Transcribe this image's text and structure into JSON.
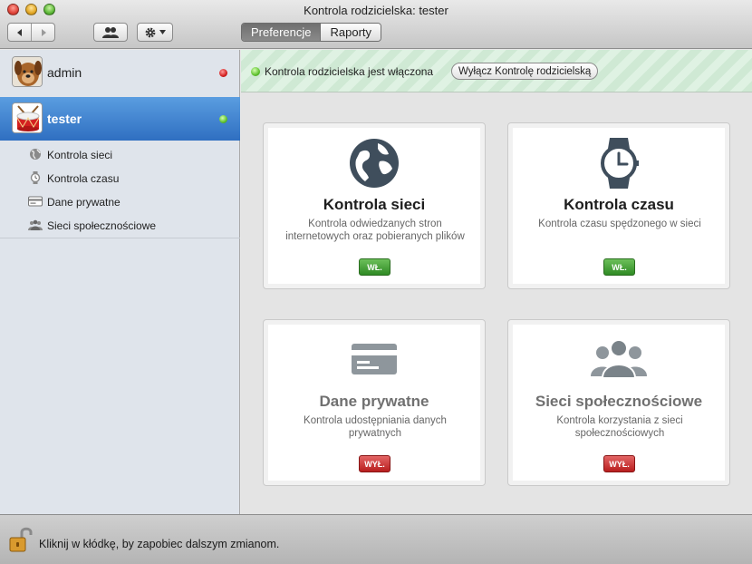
{
  "window": {
    "title": "Kontrola rodzicielska: tester"
  },
  "toolbar": {
    "back_icon": "chevron-left-icon",
    "forward_icon": "chevron-right-icon",
    "users_icon": "users-icon",
    "gear_icon": "gear-icon",
    "tabs": [
      {
        "label": "Preferencje",
        "active": true
      },
      {
        "label": "Raporty",
        "active": false
      }
    ]
  },
  "sidebar": {
    "users": [
      {
        "name": "admin",
        "status": "red"
      },
      {
        "name": "tester",
        "status": "green",
        "selected": true
      }
    ],
    "items": [
      {
        "label": "Kontrola sieci",
        "icon": "globe-icon"
      },
      {
        "label": "Kontrola czasu",
        "icon": "watch-icon"
      },
      {
        "label": "Dane prywatne",
        "icon": "card-icon"
      },
      {
        "label": "Sieci społecznościowe",
        "icon": "people-icon"
      }
    ]
  },
  "banner": {
    "status_text": "Kontrola rodzicielska jest włączona",
    "button_label": "Wyłącz Kontrolę rodzicielską"
  },
  "cards": [
    {
      "title": "Kontrola sieci",
      "desc": "Kontrola odwiedzanych stron internetowych oraz pobieranych plików",
      "toggle": "WŁ.",
      "state": "on",
      "icon": "globe-icon"
    },
    {
      "title": "Kontrola czasu",
      "desc": "Kontrola czasu spędzonego w sieci",
      "toggle": "WŁ.",
      "state": "on",
      "icon": "watch-icon"
    },
    {
      "title": "Dane prywatne",
      "desc": "Kontrola udostępniania danych prywatnych",
      "toggle": "WYŁ.",
      "state": "off",
      "icon": "card-icon"
    },
    {
      "title": "Sieci społecznościowe",
      "desc": "Kontrola korzystania z sieci społecznościowych",
      "toggle": "WYŁ.",
      "state": "off",
      "icon": "people-icon"
    }
  ],
  "footer": {
    "lock_text": "Kliknij w kłódkę, by zapobiec dalszym zmianom.",
    "lock_icon": "lock-open-icon"
  },
  "colors": {
    "selection": "#3a7bd5",
    "on": "#3c9a2c",
    "off": "#c52828",
    "banner_bg": "#d8efdc"
  }
}
